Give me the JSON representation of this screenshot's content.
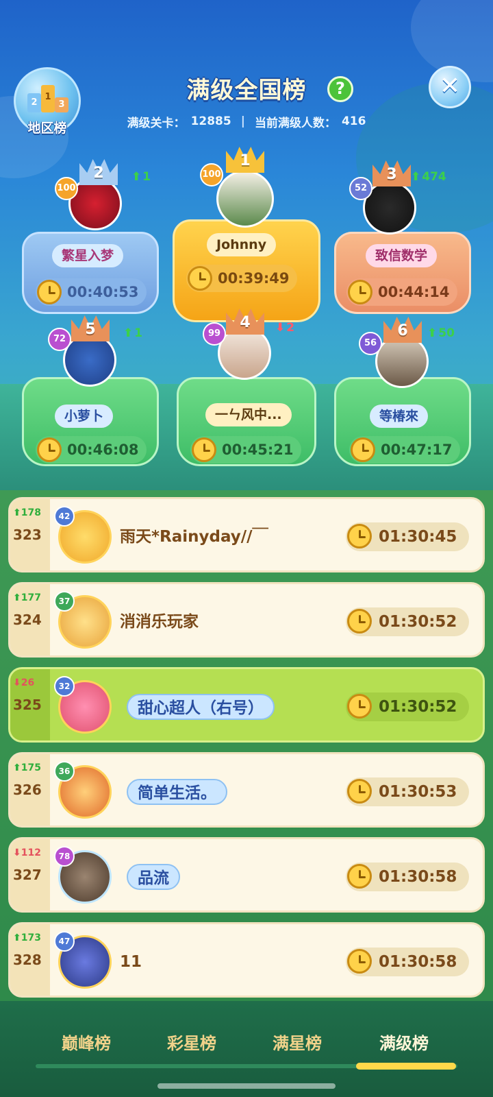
{
  "header": {
    "title": "满级全国榜",
    "help_icon": "?",
    "close_icon": "✕",
    "region_button_label": "地区榜",
    "stats_level_label": "满级关卡：",
    "stats_level_value": "12885",
    "stats_players_label": "当前满级人数：",
    "stats_players_value": "416"
  },
  "podium": [
    {
      "rank": "1",
      "level": "100",
      "name": "Johnny",
      "time": "00:39:49",
      "delta": ""
    },
    {
      "rank": "2",
      "level": "100",
      "name": "繁星入梦",
      "time": "00:40:53",
      "delta": "1",
      "delta_dir": "up"
    },
    {
      "rank": "3",
      "level": "52",
      "name": "致信数学",
      "time": "00:44:14",
      "delta": "474",
      "delta_dir": "up"
    },
    {
      "rank": "4",
      "level": "99",
      "name": "一ㄣ风中...",
      "time": "00:45:21",
      "delta": "2",
      "delta_dir": "down"
    },
    {
      "rank": "5",
      "level": "72",
      "name": "小萝卜",
      "time": "00:46:08",
      "delta": "1",
      "delta_dir": "up"
    },
    {
      "rank": "6",
      "level": "56",
      "name": "等椿來",
      "time": "00:47:17",
      "delta": "50",
      "delta_dir": "up"
    }
  ],
  "list": [
    {
      "rank": "323",
      "delta": "178",
      "delta_dir": "up",
      "level": "42",
      "name": "雨天*Rainyday//￣",
      "time": "01:30:45"
    },
    {
      "rank": "324",
      "delta": "177",
      "delta_dir": "up",
      "level": "37",
      "name": "消消乐玩家",
      "time": "01:30:52"
    },
    {
      "rank": "325",
      "delta": "26",
      "delta_dir": "down",
      "level": "32",
      "name": "甜心超人（右号）",
      "time": "01:30:52"
    },
    {
      "rank": "326",
      "delta": "175",
      "delta_dir": "up",
      "level": "36",
      "name": "简单生活。",
      "time": "01:30:53"
    },
    {
      "rank": "327",
      "delta": "112",
      "delta_dir": "down",
      "level": "78",
      "name": "品流",
      "time": "01:30:58"
    },
    {
      "rank": "328",
      "delta": "173",
      "delta_dir": "up",
      "level": "47",
      "name": "11",
      "time": "01:30:58"
    }
  ],
  "tabs": [
    {
      "label": "巅峰榜"
    },
    {
      "label": "彩星榜"
    },
    {
      "label": "满星榜"
    },
    {
      "label": "满级榜"
    }
  ],
  "arrows": {
    "up": "⬆",
    "down": "⬇"
  },
  "colors": {
    "gold": "#f5a416",
    "blue_podium": "#6f9fe0",
    "peach_podium": "#ea8e66",
    "green_podium": "#3ebd67",
    "highlight_row": "#b5df52"
  }
}
